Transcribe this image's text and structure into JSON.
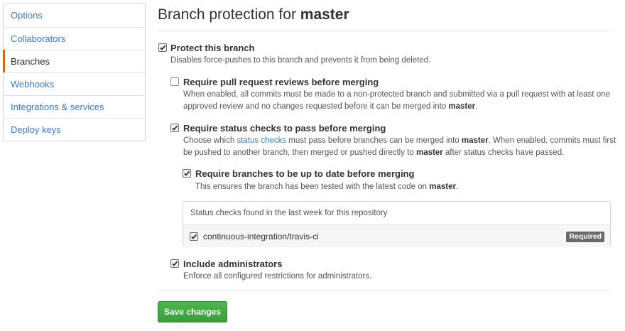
{
  "sidebar": {
    "items": [
      {
        "label": "Options",
        "active": false
      },
      {
        "label": "Collaborators",
        "active": false
      },
      {
        "label": "Branches",
        "active": true
      },
      {
        "label": "Webhooks",
        "active": false
      },
      {
        "label": "Integrations & services",
        "active": false
      },
      {
        "label": "Deploy keys",
        "active": false
      }
    ]
  },
  "header": {
    "title_prefix": "Branch protection for ",
    "branch": "master"
  },
  "protect": {
    "label": "Protect this branch",
    "checked": true,
    "note": "Disables force-pushes to this branch and prevents it from being deleted."
  },
  "reviews": {
    "label": "Require pull request reviews before merging",
    "checked": false,
    "note_line1": "When enabled, all commits must be made to a non-protected branch and submitted via a pull request with at least one",
    "note_line2_prefix": "approved review and no changes requested before it can be merged into ",
    "note_line2_branch": "master",
    "note_line2_suffix": "."
  },
  "status_checks": {
    "label": "Require status checks to pass before merging",
    "checked": true,
    "note_line1_a": "Choose which ",
    "note_line1_link": "status checks",
    "note_line1_b": " must pass before branches can be merged into ",
    "note_line1_branch": "master",
    "note_line1_c": ". When enabled, commits must first",
    "note_line2_a": "be pushed to another branch, then merged or pushed directly to ",
    "note_line2_branch": "master",
    "note_line2_b": " after status checks have passed."
  },
  "up_to_date": {
    "label": "Require branches to be up to date before merging",
    "checked": true,
    "note_prefix": "This ensures the branch has been tested with the latest code on ",
    "note_branch": "master",
    "note_suffix": "."
  },
  "status_list": {
    "header": "Status checks found in the last week for this repository",
    "checks": [
      {
        "name": "continuous-integration/travis-ci",
        "checked": true,
        "badge": "Required"
      }
    ]
  },
  "admins": {
    "label": "Include administrators",
    "checked": true,
    "note": "Enforce all configured restrictions for administrators."
  },
  "save_button": "Save changes",
  "colors": {
    "link": "#4078c0",
    "active_indicator": "#d26911",
    "save_green": "#36a037",
    "badge_gray": "#6a6a6a"
  }
}
